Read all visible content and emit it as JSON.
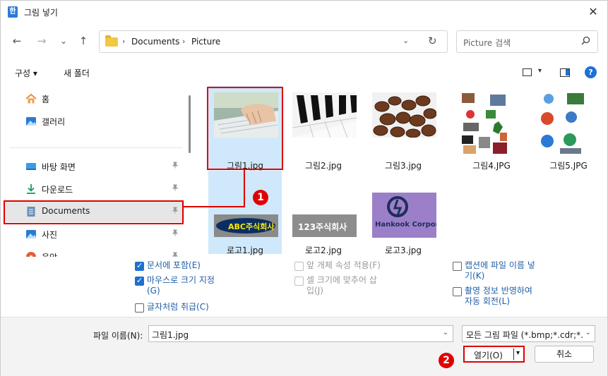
{
  "window": {
    "title": "그림 넣기",
    "app_icon_glyph": "한",
    "close_glyph": "✕"
  },
  "nav": {
    "back_glyph": "←",
    "forward_glyph": "→",
    "recent_glyph": "⌄",
    "up_glyph": "↑",
    "breadcrumb": [
      "Documents",
      "Picture"
    ],
    "crumb_sep": "›",
    "dropdown_glyph": "⌄",
    "refresh_glyph": "↻",
    "search_placeholder": "Picture 검색",
    "search_glyph": "⌕"
  },
  "commandbar": {
    "organize": "구성 ▾",
    "new_folder": "새 폴더",
    "help_glyph": "?",
    "view_chev": "▾"
  },
  "sidebar": {
    "items": [
      {
        "label": "홈",
        "icon": "home-icon"
      },
      {
        "label": "갤러리",
        "icon": "gallery-icon"
      },
      {
        "label": "바탕 화면",
        "icon": "desktop-icon",
        "pinned": true
      },
      {
        "label": "다운로드",
        "icon": "download-icon",
        "pinned": true
      },
      {
        "label": "Documents",
        "icon": "documents-icon",
        "pinned": true,
        "selected": true
      },
      {
        "label": "사진",
        "icon": "pictures-icon",
        "pinned": true
      },
      {
        "label": "음악",
        "icon": "music-icon",
        "pinned": true
      }
    ],
    "pin_glyph": "📌"
  },
  "files": [
    {
      "name": "그림1.jpg",
      "selected": true
    },
    {
      "name": "그림2.jpg"
    },
    {
      "name": "그림3.jpg"
    },
    {
      "name": "그림4.JPG"
    },
    {
      "name": "그림5.JPG"
    },
    {
      "name": "로고1.jpg",
      "selected": true,
      "logo_text": "ABC주식회사"
    },
    {
      "name": "로고2.jpg",
      "logo_text": "123주식회사"
    },
    {
      "name": "로고3.jpg",
      "logo_text": "Hankook Corporation"
    }
  ],
  "options": {
    "include_in_doc": {
      "label": "문서에 포함(E)",
      "checked": true
    },
    "mouse_size": {
      "label": "마우스로 크기 지정",
      "label2": "(G)",
      "checked": true
    },
    "treat_as_char": {
      "label": "글자처럼 취급(C)",
      "checked": false
    },
    "apply_front_attr": {
      "label": "앞 개체 속성 적용(F)",
      "checked": false,
      "disabled": true
    },
    "fit_cell": {
      "label": "셀 크기에 맞추어 삽",
      "label2": "입(J)",
      "checked": false,
      "disabled": true
    },
    "caption_filename": {
      "label": "캡션에 파일 이름 넣",
      "label2": "기(K)",
      "checked": false
    },
    "exif_rotate": {
      "label": "촬영 정보 반영하여",
      "label2": "자동 회전(L)",
      "checked": false
    }
  },
  "bottom": {
    "filename_label": "파일 이름(N):",
    "filename_value": "그림1.jpg",
    "filetype_value": "모든 그림 파일 (*.bmp;*.cdr;*.c",
    "open_label": "열기(O)",
    "cancel_label": "취소",
    "dropdown_glyph": "⌄",
    "open_chev": "▾"
  },
  "annotations": {
    "marker1": "1",
    "marker2": "2"
  },
  "colors": {
    "accent": "#1f6fd0",
    "annotation_red": "#e00000",
    "selection": "#cfe8fb"
  }
}
